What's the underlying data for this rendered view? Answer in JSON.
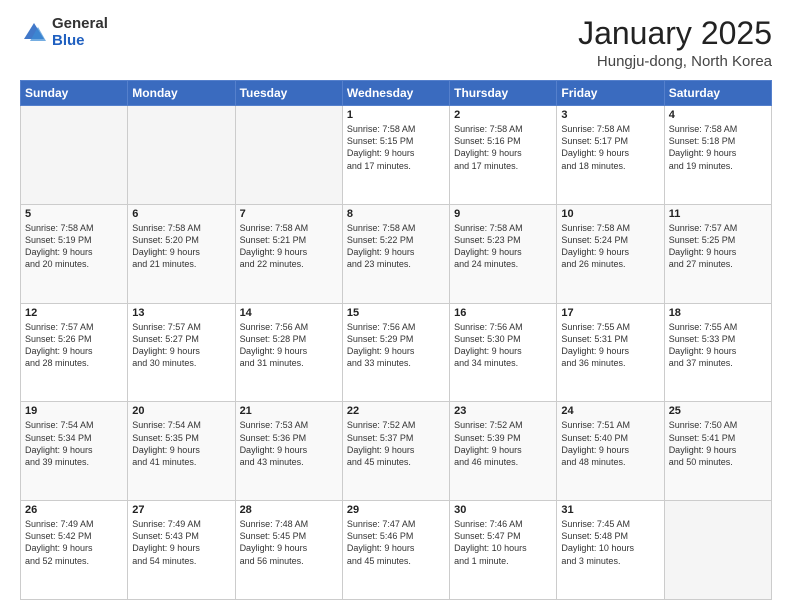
{
  "header": {
    "logo_general": "General",
    "logo_blue": "Blue",
    "month_title": "January 2025",
    "location": "Hungju-dong, North Korea"
  },
  "weekdays": [
    "Sunday",
    "Monday",
    "Tuesday",
    "Wednesday",
    "Thursday",
    "Friday",
    "Saturday"
  ],
  "weeks": [
    [
      {
        "day": "",
        "text": ""
      },
      {
        "day": "",
        "text": ""
      },
      {
        "day": "",
        "text": ""
      },
      {
        "day": "1",
        "text": "Sunrise: 7:58 AM\nSunset: 5:15 PM\nDaylight: 9 hours\nand 17 minutes."
      },
      {
        "day": "2",
        "text": "Sunrise: 7:58 AM\nSunset: 5:16 PM\nDaylight: 9 hours\nand 17 minutes."
      },
      {
        "day": "3",
        "text": "Sunrise: 7:58 AM\nSunset: 5:17 PM\nDaylight: 9 hours\nand 18 minutes."
      },
      {
        "day": "4",
        "text": "Sunrise: 7:58 AM\nSunset: 5:18 PM\nDaylight: 9 hours\nand 19 minutes."
      }
    ],
    [
      {
        "day": "5",
        "text": "Sunrise: 7:58 AM\nSunset: 5:19 PM\nDaylight: 9 hours\nand 20 minutes."
      },
      {
        "day": "6",
        "text": "Sunrise: 7:58 AM\nSunset: 5:20 PM\nDaylight: 9 hours\nand 21 minutes."
      },
      {
        "day": "7",
        "text": "Sunrise: 7:58 AM\nSunset: 5:21 PM\nDaylight: 9 hours\nand 22 minutes."
      },
      {
        "day": "8",
        "text": "Sunrise: 7:58 AM\nSunset: 5:22 PM\nDaylight: 9 hours\nand 23 minutes."
      },
      {
        "day": "9",
        "text": "Sunrise: 7:58 AM\nSunset: 5:23 PM\nDaylight: 9 hours\nand 24 minutes."
      },
      {
        "day": "10",
        "text": "Sunrise: 7:58 AM\nSunset: 5:24 PM\nDaylight: 9 hours\nand 26 minutes."
      },
      {
        "day": "11",
        "text": "Sunrise: 7:57 AM\nSunset: 5:25 PM\nDaylight: 9 hours\nand 27 minutes."
      }
    ],
    [
      {
        "day": "12",
        "text": "Sunrise: 7:57 AM\nSunset: 5:26 PM\nDaylight: 9 hours\nand 28 minutes."
      },
      {
        "day": "13",
        "text": "Sunrise: 7:57 AM\nSunset: 5:27 PM\nDaylight: 9 hours\nand 30 minutes."
      },
      {
        "day": "14",
        "text": "Sunrise: 7:56 AM\nSunset: 5:28 PM\nDaylight: 9 hours\nand 31 minutes."
      },
      {
        "day": "15",
        "text": "Sunrise: 7:56 AM\nSunset: 5:29 PM\nDaylight: 9 hours\nand 33 minutes."
      },
      {
        "day": "16",
        "text": "Sunrise: 7:56 AM\nSunset: 5:30 PM\nDaylight: 9 hours\nand 34 minutes."
      },
      {
        "day": "17",
        "text": "Sunrise: 7:55 AM\nSunset: 5:31 PM\nDaylight: 9 hours\nand 36 minutes."
      },
      {
        "day": "18",
        "text": "Sunrise: 7:55 AM\nSunset: 5:33 PM\nDaylight: 9 hours\nand 37 minutes."
      }
    ],
    [
      {
        "day": "19",
        "text": "Sunrise: 7:54 AM\nSunset: 5:34 PM\nDaylight: 9 hours\nand 39 minutes."
      },
      {
        "day": "20",
        "text": "Sunrise: 7:54 AM\nSunset: 5:35 PM\nDaylight: 9 hours\nand 41 minutes."
      },
      {
        "day": "21",
        "text": "Sunrise: 7:53 AM\nSunset: 5:36 PM\nDaylight: 9 hours\nand 43 minutes."
      },
      {
        "day": "22",
        "text": "Sunrise: 7:52 AM\nSunset: 5:37 PM\nDaylight: 9 hours\nand 45 minutes."
      },
      {
        "day": "23",
        "text": "Sunrise: 7:52 AM\nSunset: 5:39 PM\nDaylight: 9 hours\nand 46 minutes."
      },
      {
        "day": "24",
        "text": "Sunrise: 7:51 AM\nSunset: 5:40 PM\nDaylight: 9 hours\nand 48 minutes."
      },
      {
        "day": "25",
        "text": "Sunrise: 7:50 AM\nSunset: 5:41 PM\nDaylight: 9 hours\nand 50 minutes."
      }
    ],
    [
      {
        "day": "26",
        "text": "Sunrise: 7:49 AM\nSunset: 5:42 PM\nDaylight: 9 hours\nand 52 minutes."
      },
      {
        "day": "27",
        "text": "Sunrise: 7:49 AM\nSunset: 5:43 PM\nDaylight: 9 hours\nand 54 minutes."
      },
      {
        "day": "28",
        "text": "Sunrise: 7:48 AM\nSunset: 5:45 PM\nDaylight: 9 hours\nand 56 minutes."
      },
      {
        "day": "29",
        "text": "Sunrise: 7:47 AM\nSunset: 5:46 PM\nDaylight: 9 hours\nand 45 minutes."
      },
      {
        "day": "30",
        "text": "Sunrise: 7:46 AM\nSunset: 5:47 PM\nDaylight: 10 hours\nand 1 minute."
      },
      {
        "day": "31",
        "text": "Sunrise: 7:45 AM\nSunset: 5:48 PM\nDaylight: 10 hours\nand 3 minutes."
      },
      {
        "day": "",
        "text": ""
      }
    ]
  ]
}
